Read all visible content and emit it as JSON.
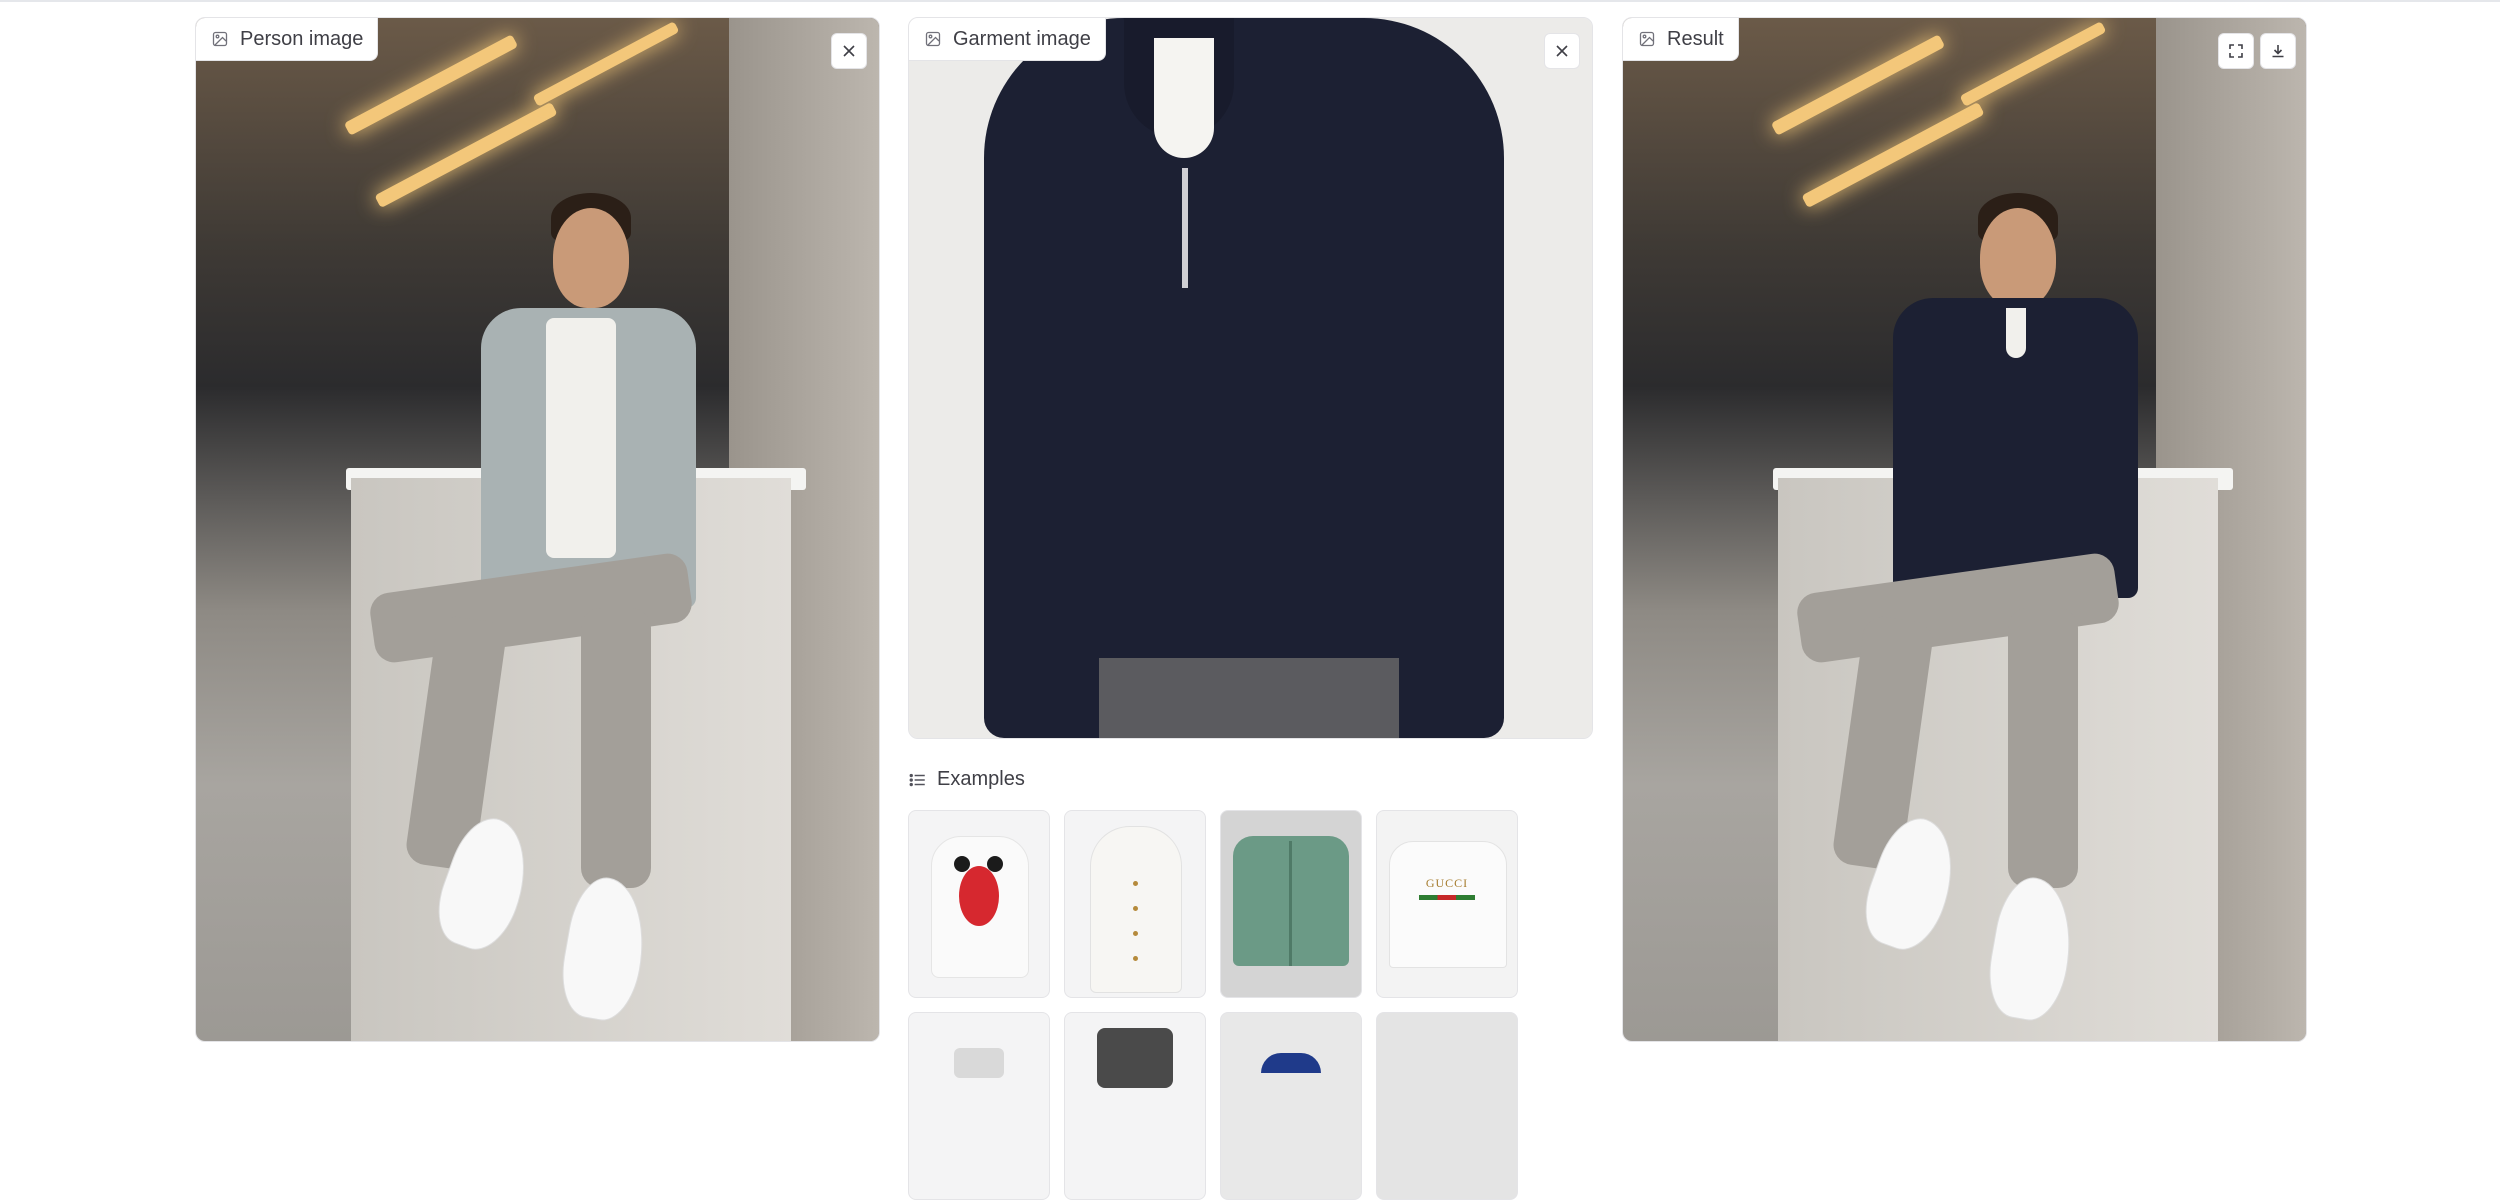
{
  "panels": {
    "person": {
      "label": "Person image",
      "icon": "image-icon"
    },
    "garment": {
      "label": "Garment image",
      "icon": "image-icon"
    },
    "result": {
      "label": "Result",
      "icon": "image-icon"
    }
  },
  "examples": {
    "label": "Examples",
    "items": [
      {
        "name": "minnie-tshirt"
      },
      {
        "name": "white-button-tank"
      },
      {
        "name": "green-suede-jacket"
      },
      {
        "name": "gucci-tshirt",
        "text": "GUCCI"
      }
    ]
  },
  "colors": {
    "border": "#e4e4e7",
    "tag_text": "#3f3f46",
    "sweater": "#1c2033"
  }
}
